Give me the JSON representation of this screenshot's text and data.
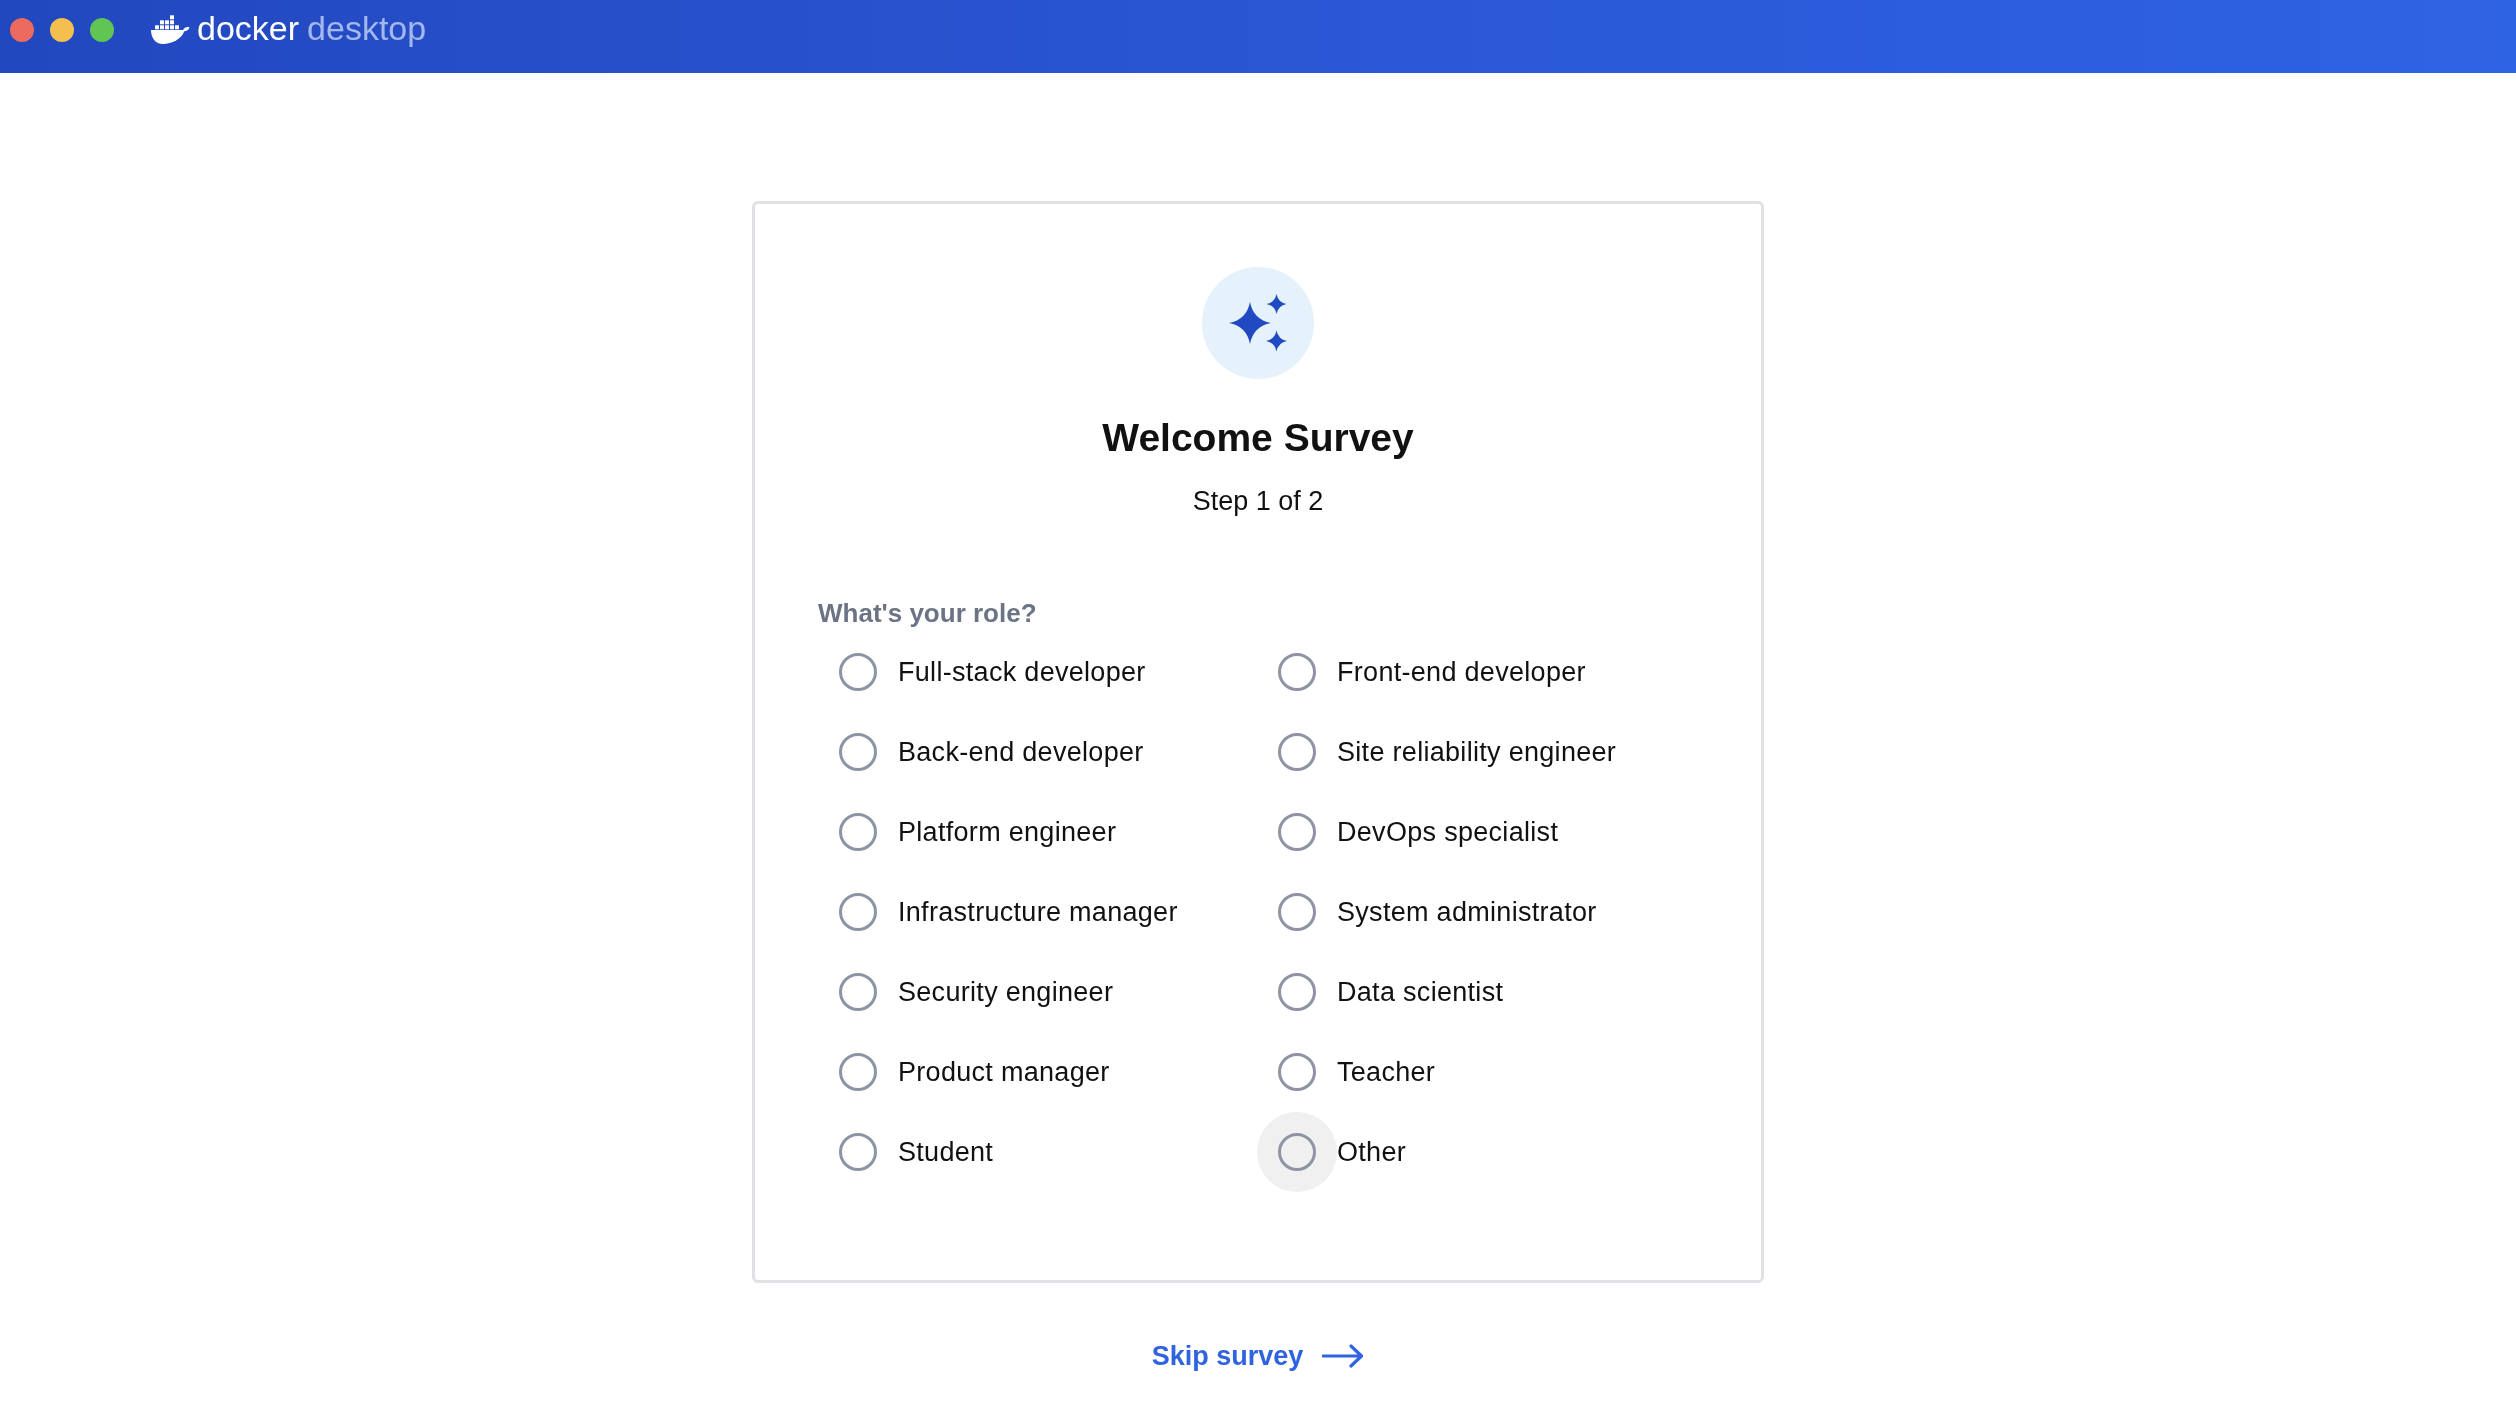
{
  "title_bar": {
    "logo": {
      "brand": "docker",
      "product": "desktop"
    }
  },
  "survey": {
    "title": "Welcome Survey",
    "step": "Step 1 of 2",
    "question": "What's your role?",
    "options": [
      {
        "label": "Full-stack developer",
        "selected": false,
        "hovered": false
      },
      {
        "label": "Front-end developer",
        "selected": false,
        "hovered": false
      },
      {
        "label": "Back-end developer",
        "selected": false,
        "hovered": false
      },
      {
        "label": "Site reliability engineer",
        "selected": false,
        "hovered": false
      },
      {
        "label": "Platform engineer",
        "selected": false,
        "hovered": false
      },
      {
        "label": "DevOps specialist",
        "selected": false,
        "hovered": false
      },
      {
        "label": "Infrastructure manager",
        "selected": false,
        "hovered": false
      },
      {
        "label": "System administrator",
        "selected": false,
        "hovered": false
      },
      {
        "label": "Security engineer",
        "selected": false,
        "hovered": false
      },
      {
        "label": "Data scientist",
        "selected": false,
        "hovered": false
      },
      {
        "label": "Product manager",
        "selected": false,
        "hovered": false
      },
      {
        "label": "Teacher",
        "selected": false,
        "hovered": false
      },
      {
        "label": "Student",
        "selected": false,
        "hovered": false
      },
      {
        "label": "Other",
        "selected": false,
        "hovered": true
      }
    ]
  },
  "skip_link": "Skip survey"
}
